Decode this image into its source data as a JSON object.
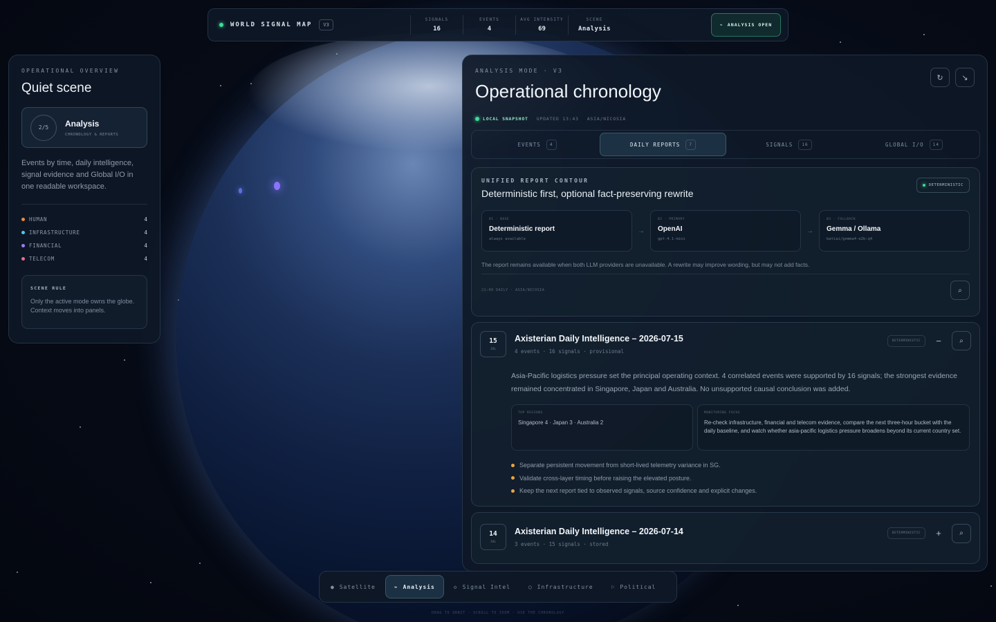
{
  "topbar": {
    "brand": "WORLD SIGNAL MAP",
    "version": "V3",
    "metrics": [
      {
        "label": "SIGNALS",
        "value": "16"
      },
      {
        "label": "EVENTS",
        "value": "4"
      },
      {
        "label": "AVG INTENSITY",
        "value": "69"
      },
      {
        "label": "SCENE",
        "value": "Analysis"
      }
    ],
    "analysis_button": "ANALYSIS OPEN"
  },
  "left": {
    "kicker": "OPERATIONAL OVERVIEW",
    "title": "Quiet scene",
    "card": {
      "ring": "2/5",
      "title": "Analysis",
      "sub": "CHRONOLOGY & REPORTS"
    },
    "description": "Events by time, daily intelligence, signal evidence and Global I/O in one readable workspace.",
    "categories": [
      {
        "name": "HUMAN",
        "count": "4",
        "color": "#f08a3c"
      },
      {
        "name": "INFRASTRUCTURE",
        "count": "4",
        "color": "#4fc3f7"
      },
      {
        "name": "FINANCIAL",
        "count": "4",
        "color": "#9d7cf6"
      },
      {
        "name": "TELECOM",
        "count": "4",
        "color": "#f06a9a"
      }
    ],
    "rule": {
      "title": "SCENE RULE",
      "body": "Only the active mode owns the globe. Context moves into panels."
    }
  },
  "main": {
    "kicker": "ANALYSIS MODE · V3",
    "title": "Operational chronology",
    "status": {
      "live": "LOCAL SNAPSHOT",
      "updated": "UPDATED 13:43",
      "tz": "ASIA/NICOSIA"
    },
    "tabs": [
      {
        "label": "EVENTS",
        "count": "4"
      },
      {
        "label": "DAILY REPORTS",
        "count": "7"
      },
      {
        "label": "SIGNALS",
        "count": "16"
      },
      {
        "label": "GLOBAL I/O",
        "count": "14"
      }
    ],
    "contour": {
      "kicker": "UNIFIED REPORT CONTOUR",
      "badge": "DETERMINISTIC",
      "title": "Deterministic first, optional fact-preserving rewrite",
      "steps": [
        {
          "tag": "01 · BASE",
          "name": "Deterministic report",
          "detail": "always available"
        },
        {
          "tag": "02 · PRIMARY",
          "name": "OpenAI",
          "detail": "gpt-4.1-mini"
        },
        {
          "tag": "03 · FALLBACK",
          "name": "Gemma / Ollama",
          "detail": "batiai/gemma4-e2b:q4"
        }
      ],
      "note": "The report remains available when both LLM providers are unavailable. A rewrite may improve wording, but may not add facts.",
      "footer": "21:00 DAILY · ASIA/NICOSIA"
    },
    "reports": [
      {
        "day": "15",
        "month": "JUL",
        "title": "Axisterian Daily Intelligence – 2026-07-15",
        "meta": "4 events · 16 signals · provisional",
        "badge": "DETERMINISTIC",
        "toggle": "−",
        "summary": "Asia-Pacific logistics pressure set the principal operating context. 4 correlated events were supported by 16 signals; the strongest evidence remained concentrated in Singapore, Japan and Australia. No unsupported causal conclusion was added.",
        "regions_label": "TOP REGIONS",
        "regions": "Singapore 4 · Japan 3 · Australia 2",
        "focus_label": "MONITORING FOCUS",
        "focus": "Re-check infrastructure, financial and telecom evidence, compare the next three-hour bucket with the daily baseline, and watch whether asia-pacific logistics pressure broadens beyond its current country set.",
        "bullets": [
          "Separate persistent movement from short-lived telemetry variance in SG.",
          "Validate cross-layer timing before raising the elevated posture.",
          "Keep the next report tied to observed signals, source confidence and explicit changes."
        ]
      },
      {
        "day": "14",
        "month": "JUL",
        "title": "Axisterian Daily Intelligence – 2026-07-14",
        "meta": "3 events · 15 signals · stored",
        "badge": "DETERMINISTIC",
        "toggle": "+"
      }
    ]
  },
  "bottom_nav": [
    {
      "label": "Satellite",
      "icon": "●"
    },
    {
      "label": "Analysis",
      "icon": "⌁"
    },
    {
      "label": "Signal Intel",
      "icon": "◇"
    },
    {
      "label": "Infrastructure",
      "icon": "○"
    },
    {
      "label": "Political",
      "icon": "⚐"
    }
  ],
  "hint": "DRAG TO ORBIT · SCROLL TO ZOOM · USE THE CHRONOLOGY",
  "colors": {
    "accent_green": "#3ddc97",
    "bullet": "#e7a642",
    "globe_marker": "#8a74ff"
  }
}
